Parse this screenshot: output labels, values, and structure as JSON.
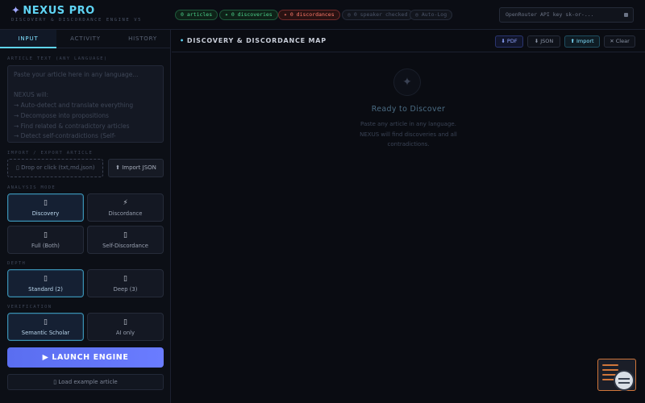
{
  "header": {
    "logo": "NEXUS PRO",
    "tagline": "DISCOVERY & DISCORDANCE ENGINE V5",
    "pills": {
      "articles": "0 articles",
      "discoveries": "0 discoveries",
      "discordances": "0 discordances",
      "speaker": "0 speaker checked",
      "autolog": "Auto-Log"
    },
    "api_key_placeholder": "OpenRouter API key  sk-or-..."
  },
  "sidebar": {
    "tabs": [
      "INPUT",
      "ACTIVITY",
      "HISTORY"
    ],
    "article_label": "ARTICLE TEXT (ANY LANGUAGE)",
    "article_placeholder": "Paste your article here in any language...\n\nNEXUS will:\n→ Auto-detect and translate everything\n→ Decompose into propositions\n→ Find related & contradictory articles\n→ Detect self-contradictions (Self-",
    "import_label": "IMPORT / EXPORT ARTICLE",
    "drop_zone": "Drop or click (txt,md,json)",
    "import_json": "Import JSON",
    "analysis_label": "ANALYSIS MODE",
    "modes": [
      {
        "icon": "▯",
        "label": "Discovery"
      },
      {
        "icon": "⚡",
        "label": "Discordance"
      },
      {
        "icon": "▯",
        "label": "Full (Both)"
      },
      {
        "icon": "▯",
        "label": "Self-Discordance"
      }
    ],
    "depth_label": "DEPTH",
    "depths": [
      {
        "icon": "▯",
        "label": "Standard (2)"
      },
      {
        "icon": "▯",
        "label": "Deep (3)"
      }
    ],
    "verification_label": "VERIFICATION",
    "verifications": [
      {
        "icon": "▯",
        "label": "Semantic Scholar"
      },
      {
        "icon": "▯",
        "label": "AI only"
      }
    ],
    "launch": "▶ LAUNCH ENGINE",
    "example": "Load example article"
  },
  "main": {
    "title": "DISCOVERY & DISCORDANCE MAP",
    "toolbar": {
      "pdf": "⬇ PDF",
      "json": "⬇ JSON",
      "import": "⬆ Import",
      "clear": "✕ Clear"
    },
    "empty_title": "Ready to Discover",
    "empty_desc_1": "Paste any article in any language.",
    "empty_desc_2": "NEXUS will find discoveries and all",
    "empty_desc_3": "contradictions."
  }
}
